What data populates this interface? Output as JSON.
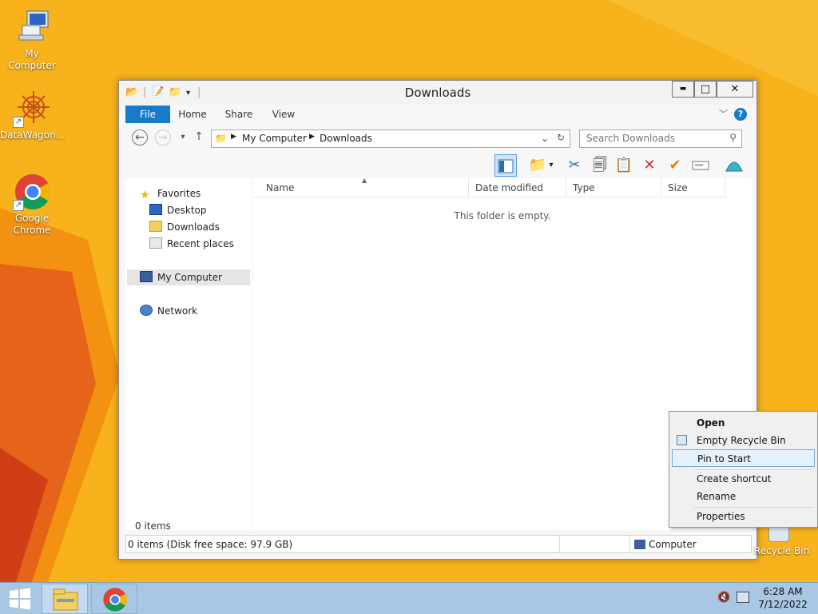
{
  "desktop": {
    "icons": [
      {
        "label": "My Computer",
        "icon": "computer-icon"
      },
      {
        "label": "DataWagon...",
        "icon": "datawagon-icon"
      },
      {
        "label": "Google Chrome",
        "icon": "chrome-icon"
      }
    ],
    "recycle_bin_label": "Recycle Bin"
  },
  "window": {
    "title": "Downloads",
    "controls": {
      "minimize": "▬",
      "maximize": "□",
      "close": "✕"
    },
    "ribbon_tabs": [
      "File",
      "Home",
      "Share",
      "View"
    ],
    "help": "?",
    "address": {
      "root": "My Computer",
      "current": "Downloads"
    },
    "search_placeholder": "Search Downloads",
    "columns": [
      "Name",
      "Date modified",
      "Type",
      "Size"
    ],
    "empty_message": "This folder is empty.",
    "nav": {
      "favorites": "Favorites",
      "favorites_items": [
        "Desktop",
        "Downloads",
        "Recent places"
      ],
      "my_computer": "My Computer",
      "network": "Network"
    },
    "items_count": "0 items",
    "status": {
      "left": "0 items (Disk free space: 97.9 GB)",
      "right": "Computer"
    }
  },
  "context_menu": {
    "items": [
      "Open",
      "Empty Recycle Bin",
      "Pin to Start",
      "Create shortcut",
      "Rename",
      "Properties"
    ],
    "highlighted": "Pin to Start"
  },
  "taskbar": {
    "time": "6:28 AM",
    "date": "7/12/2022"
  },
  "colors": {
    "accent": "#1979ca",
    "desktop": "#f7b21c",
    "taskbar": "#a8c7e4"
  }
}
